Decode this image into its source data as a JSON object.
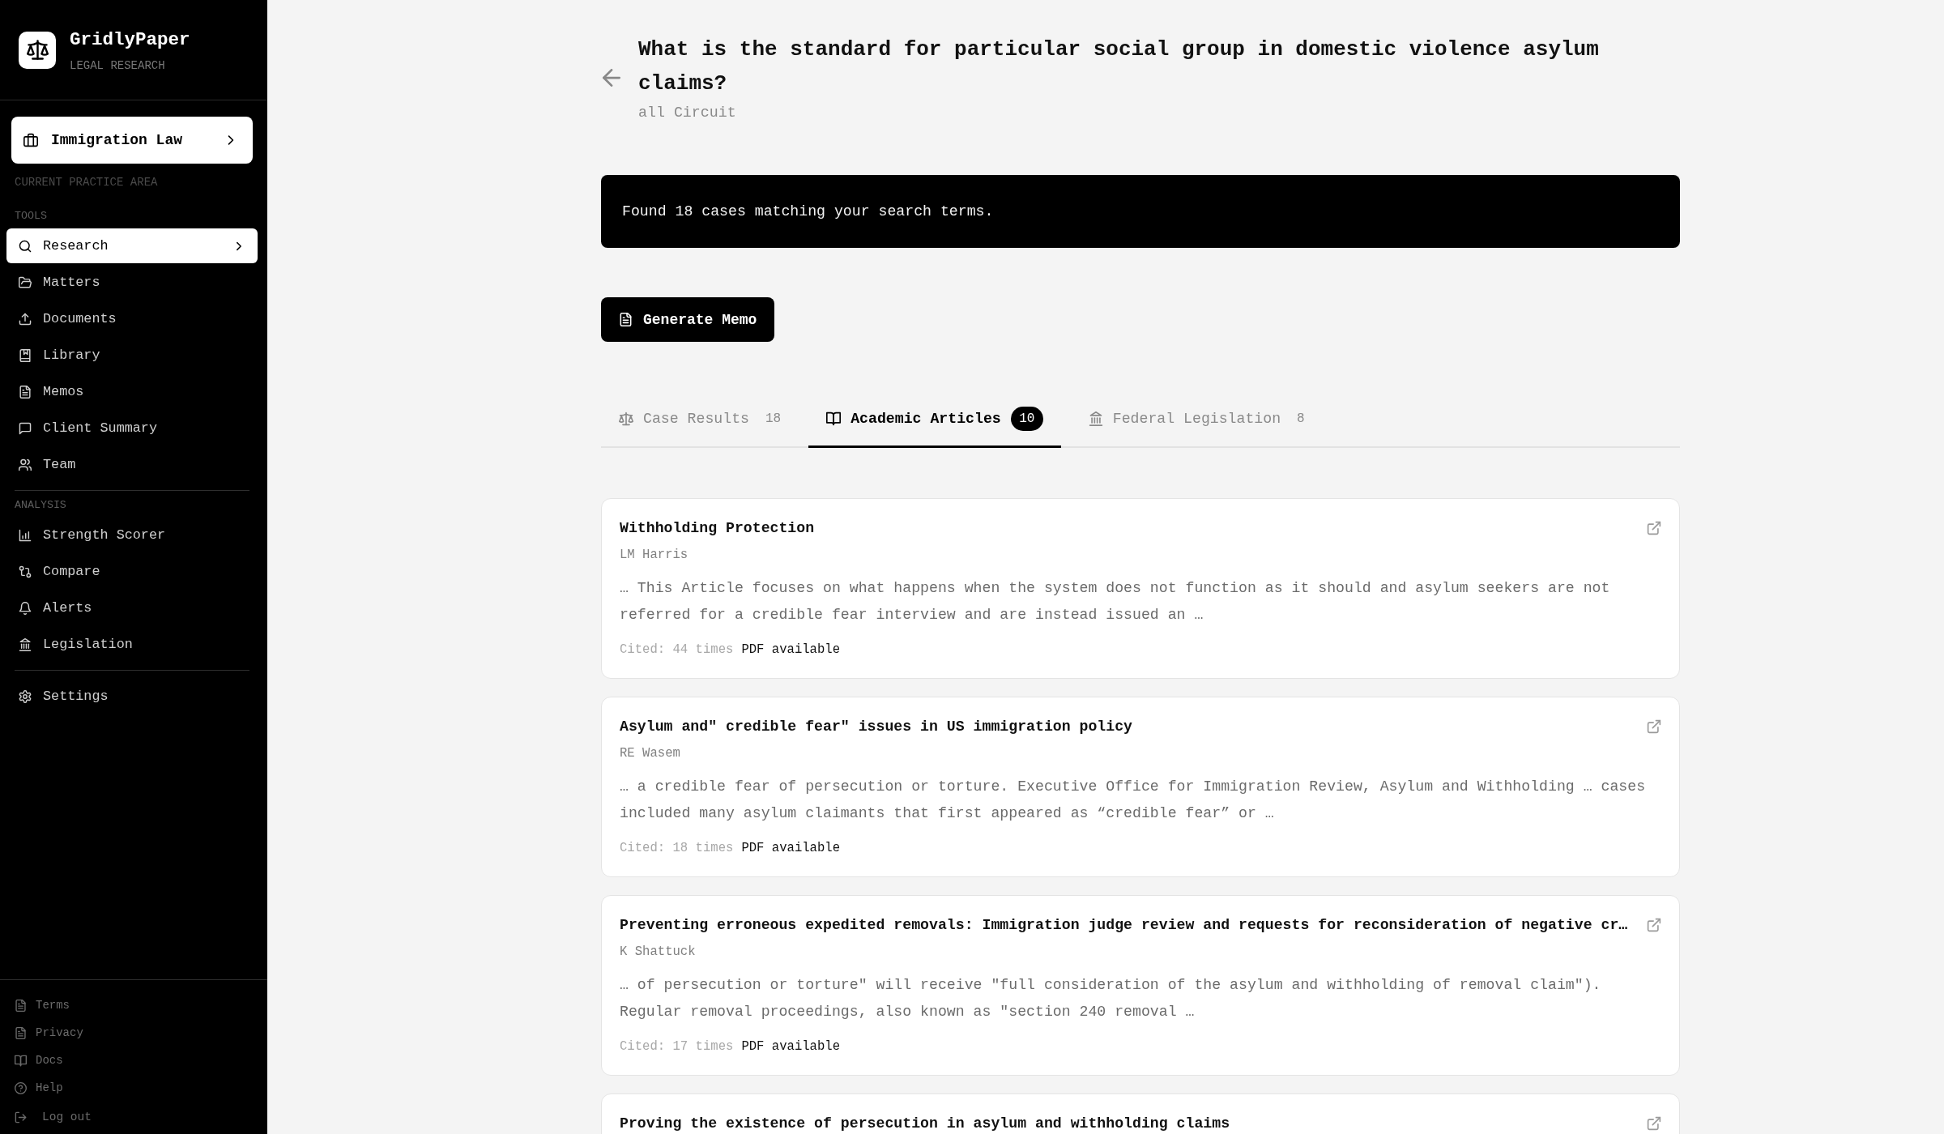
{
  "sidebar": {
    "brand": {
      "name": "GridlyPaper",
      "tagline": "LEGAL RESEARCH"
    },
    "practice_area": {
      "label": "Immigration Law",
      "caption": "CURRENT PRACTICE AREA"
    },
    "sections": [
      {
        "heading": "TOOLS",
        "items": [
          {
            "label": "Research",
            "selected": true
          },
          {
            "label": "Matters",
            "selected": false
          },
          {
            "label": "Documents",
            "selected": false
          },
          {
            "label": "Library",
            "selected": false
          },
          {
            "label": "Memos",
            "selected": false
          },
          {
            "label": "Client Summary",
            "selected": false
          },
          {
            "label": "Team",
            "selected": false
          }
        ]
      },
      {
        "heading": "ANALYSIS",
        "items": [
          {
            "label": "Strength Scorer",
            "selected": false
          },
          {
            "label": "Compare",
            "selected": false
          },
          {
            "label": "Alerts",
            "selected": false
          },
          {
            "label": "Legislation",
            "selected": false
          }
        ]
      },
      {
        "items": [
          {
            "label": "Settings",
            "selected": false
          }
        ]
      }
    ],
    "footer_links": [
      "Terms",
      "Privacy",
      "Docs",
      "Help"
    ],
    "log_out": {
      "label": "Log out"
    }
  },
  "header": {
    "title": "What is the standard for particular social group in domestic violence asylum claims?",
    "subtitle": "all Circuit"
  },
  "banner": {
    "message": "Found 18 cases matching your search terms."
  },
  "generate_button": {
    "label": "Generate Memo"
  },
  "tabs": [
    {
      "label": "Case Results",
      "count": "18",
      "selected": false
    },
    {
      "label": "Academic Articles",
      "count": "10",
      "selected": true
    },
    {
      "label": "Federal Legislation",
      "count": "8",
      "selected": false
    }
  ],
  "articles": [
    {
      "title": "Withholding Protection",
      "author": "LM Harris",
      "snippet": "… This Article focuses on what happens when the system does not function as it should and asylum seekers are not referred for a credible fear interview and are instead issued an …",
      "cited": "Cited: 44 times",
      "availability": "PDF available"
    },
    {
      "title": "Asylum and\" credible fear\" issues in US immigration policy",
      "author": "RE Wasem",
      "snippet": "… a credible fear of persecution or torture. Executive Office for Immigration Review, Asylum and Withholding … cases included many asylum claimants that first appeared as “credible fear” or …",
      "cited": "Cited: 18 times",
      "availability": "PDF available"
    },
    {
      "title": "Preventing erroneous expedited removals: Immigration judge review and requests for reconsideration of negative cr…",
      "author": "K Shattuck",
      "snippet": "… of persecution or torture\" will receive \"full consideration of the asylum and withholding of removal claim\"). Regular removal proceedings, also known as \"section 240 removal …",
      "cited": "Cited: 17 times",
      "availability": "PDF available"
    },
    {
      "title": "Proving the existence of persecution in asylum and withholding claims"
    }
  ]
}
